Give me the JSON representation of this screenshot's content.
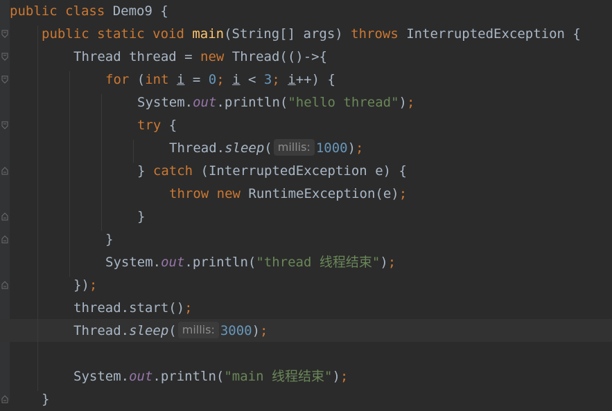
{
  "editor": {
    "lines": [
      {
        "indent": 0,
        "tokens": [
          {
            "t": "public class ",
            "c": "kw"
          },
          {
            "t": "Demo9 {",
            "c": ""
          }
        ]
      },
      {
        "indent": 1,
        "tokens": [
          {
            "t": "public static void ",
            "c": "kw"
          },
          {
            "t": "main",
            "c": "fn"
          },
          {
            "t": "(String[] args) ",
            "c": ""
          },
          {
            "t": "throws ",
            "c": "kw"
          },
          {
            "t": "InterruptedException {",
            "c": ""
          }
        ]
      },
      {
        "indent": 2,
        "tokens": [
          {
            "t": "Thread thread = ",
            "c": ""
          },
          {
            "t": "new ",
            "c": "kw"
          },
          {
            "t": "Thread(()->{",
            "c": ""
          }
        ]
      },
      {
        "indent": 3,
        "tokens": [
          {
            "t": "for ",
            "c": "kw"
          },
          {
            "t": "(",
            "c": ""
          },
          {
            "t": "int ",
            "c": "kw"
          },
          {
            "t": "i",
            "c": "var-u"
          },
          {
            "t": " = ",
            "c": ""
          },
          {
            "t": "0",
            "c": "num"
          },
          {
            "t": "; ",
            "c": "kw"
          },
          {
            "t": "i",
            "c": "var-u"
          },
          {
            "t": " < ",
            "c": ""
          },
          {
            "t": "3",
            "c": "num"
          },
          {
            "t": "; ",
            "c": "kw"
          },
          {
            "t": "i",
            "c": "var-u"
          },
          {
            "t": "++) {",
            "c": ""
          }
        ]
      },
      {
        "indent": 4,
        "tokens": [
          {
            "t": "System.",
            "c": ""
          },
          {
            "t": "out",
            "c": "field"
          },
          {
            "t": ".println(",
            "c": ""
          },
          {
            "t": "\"hello thread\"",
            "c": "str"
          },
          {
            "t": ")",
            "c": ""
          },
          {
            "t": ";",
            "c": "kw"
          }
        ]
      },
      {
        "indent": 4,
        "tokens": [
          {
            "t": "try ",
            "c": "kw"
          },
          {
            "t": "{",
            "c": ""
          }
        ]
      },
      {
        "indent": 5,
        "tokens": [
          {
            "t": "Thread.",
            "c": ""
          },
          {
            "t": "sleep",
            "c": "static-m"
          },
          {
            "t": "(",
            "c": ""
          },
          {
            "t": "millis:",
            "c": "hint"
          },
          {
            "t": "1000",
            "c": "num"
          },
          {
            "t": ")",
            "c": ""
          },
          {
            "t": ";",
            "c": "kw"
          }
        ]
      },
      {
        "indent": 4,
        "tokens": [
          {
            "t": "} ",
            "c": ""
          },
          {
            "t": "catch ",
            "c": "kw"
          },
          {
            "t": "(InterruptedException e) {",
            "c": ""
          }
        ]
      },
      {
        "indent": 5,
        "tokens": [
          {
            "t": "throw ",
            "c": "kw"
          },
          {
            "t": "new ",
            "c": "kw"
          },
          {
            "t": "RuntimeException(e)",
            "c": ""
          },
          {
            "t": ";",
            "c": "kw"
          }
        ]
      },
      {
        "indent": 4,
        "tokens": [
          {
            "t": "}",
            "c": ""
          }
        ]
      },
      {
        "indent": 3,
        "tokens": [
          {
            "t": "}",
            "c": ""
          }
        ]
      },
      {
        "indent": 3,
        "tokens": [
          {
            "t": "System.",
            "c": ""
          },
          {
            "t": "out",
            "c": "field"
          },
          {
            "t": ".println(",
            "c": ""
          },
          {
            "t": "\"thread 线程结束\"",
            "c": "str"
          },
          {
            "t": ")",
            "c": ""
          },
          {
            "t": ";",
            "c": "kw"
          }
        ]
      },
      {
        "indent": 2,
        "tokens": [
          {
            "t": "})",
            "c": ""
          },
          {
            "t": ";",
            "c": "kw"
          }
        ]
      },
      {
        "indent": 2,
        "tokens": [
          {
            "t": "thread.start()",
            "c": ""
          },
          {
            "t": ";",
            "c": "kw"
          }
        ]
      },
      {
        "indent": 2,
        "tokens": [
          {
            "t": "Thread.",
            "c": ""
          },
          {
            "t": "sleep",
            "c": "static-m"
          },
          {
            "t": "(",
            "c": ""
          },
          {
            "t": "millis:",
            "c": "hint"
          },
          {
            "t": "3000",
            "c": "num"
          },
          {
            "t": ")",
            "c": ""
          },
          {
            "t": ";",
            "c": "kw"
          }
        ]
      },
      {
        "indent": 0,
        "tokens": []
      },
      {
        "indent": 2,
        "tokens": [
          {
            "t": "System.",
            "c": ""
          },
          {
            "t": "out",
            "c": "field"
          },
          {
            "t": ".println(",
            "c": ""
          },
          {
            "t": "\"main 线程结束\"",
            "c": "str"
          },
          {
            "t": ")",
            "c": ""
          },
          {
            "t": ";",
            "c": "kw"
          }
        ]
      },
      {
        "indent": 1,
        "tokens": [
          {
            "t": "}",
            "c": ""
          }
        ]
      }
    ],
    "current_line_index": 14
  },
  "colors": {
    "background": "#2b2b2b",
    "keyword": "#cc7832",
    "method_decl": "#ffc66d",
    "string": "#6a8759",
    "number": "#6897bb",
    "field": "#9876aa",
    "default": "#a9b7c6"
  }
}
